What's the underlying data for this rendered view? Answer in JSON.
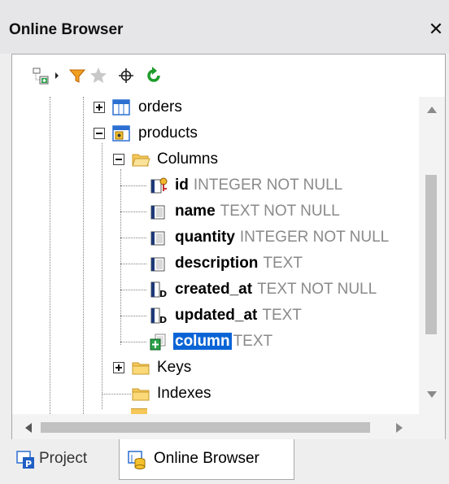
{
  "panel": {
    "title": "Online Browser",
    "close_glyph": "✕"
  },
  "toolbar": {
    "icons": [
      "add-object-icon",
      "dropdown-arrow-icon",
      "filter-icon",
      "favorite-star-icon",
      "locate-icon",
      "refresh-icon"
    ]
  },
  "tree": {
    "orders": {
      "label": "orders",
      "icon": "table-icon",
      "expander": "plus"
    },
    "products": {
      "label": "products",
      "icon": "table-selected-icon",
      "expander": "minus"
    },
    "columns_folder": {
      "label": "Columns",
      "expander": "minus"
    },
    "columns": [
      {
        "name": "id",
        "type": "INTEGER NOT NULL",
        "icon": "primary-key-column-icon"
      },
      {
        "name": "name",
        "type": "TEXT NOT NULL",
        "icon": "column-icon"
      },
      {
        "name": "quantity",
        "type": "INTEGER NOT NULL",
        "icon": "column-icon"
      },
      {
        "name": "description",
        "type": "TEXT",
        "icon": "column-icon"
      },
      {
        "name": "created_at",
        "type": "TEXT NOT NULL",
        "icon": "default-column-icon"
      },
      {
        "name": "updated_at",
        "type": "TEXT",
        "icon": "default-column-icon"
      },
      {
        "name": "column",
        "type": "TEXT",
        "icon": "new-column-icon",
        "selected": true
      }
    ],
    "keys_folder": {
      "label": "Keys",
      "expander": "plus"
    },
    "indexes_folder": {
      "label": "Indexes"
    }
  },
  "tabs": [
    {
      "label": "Project",
      "active": false,
      "icon": "project-icon"
    },
    {
      "label": "Online Browser",
      "active": true,
      "icon": "online-browser-icon"
    }
  ],
  "colors": {
    "selection": "#0a64d6",
    "type_text": "#8a8a8a",
    "folder": "#f5c858",
    "refresh": "#1e9c2c"
  }
}
